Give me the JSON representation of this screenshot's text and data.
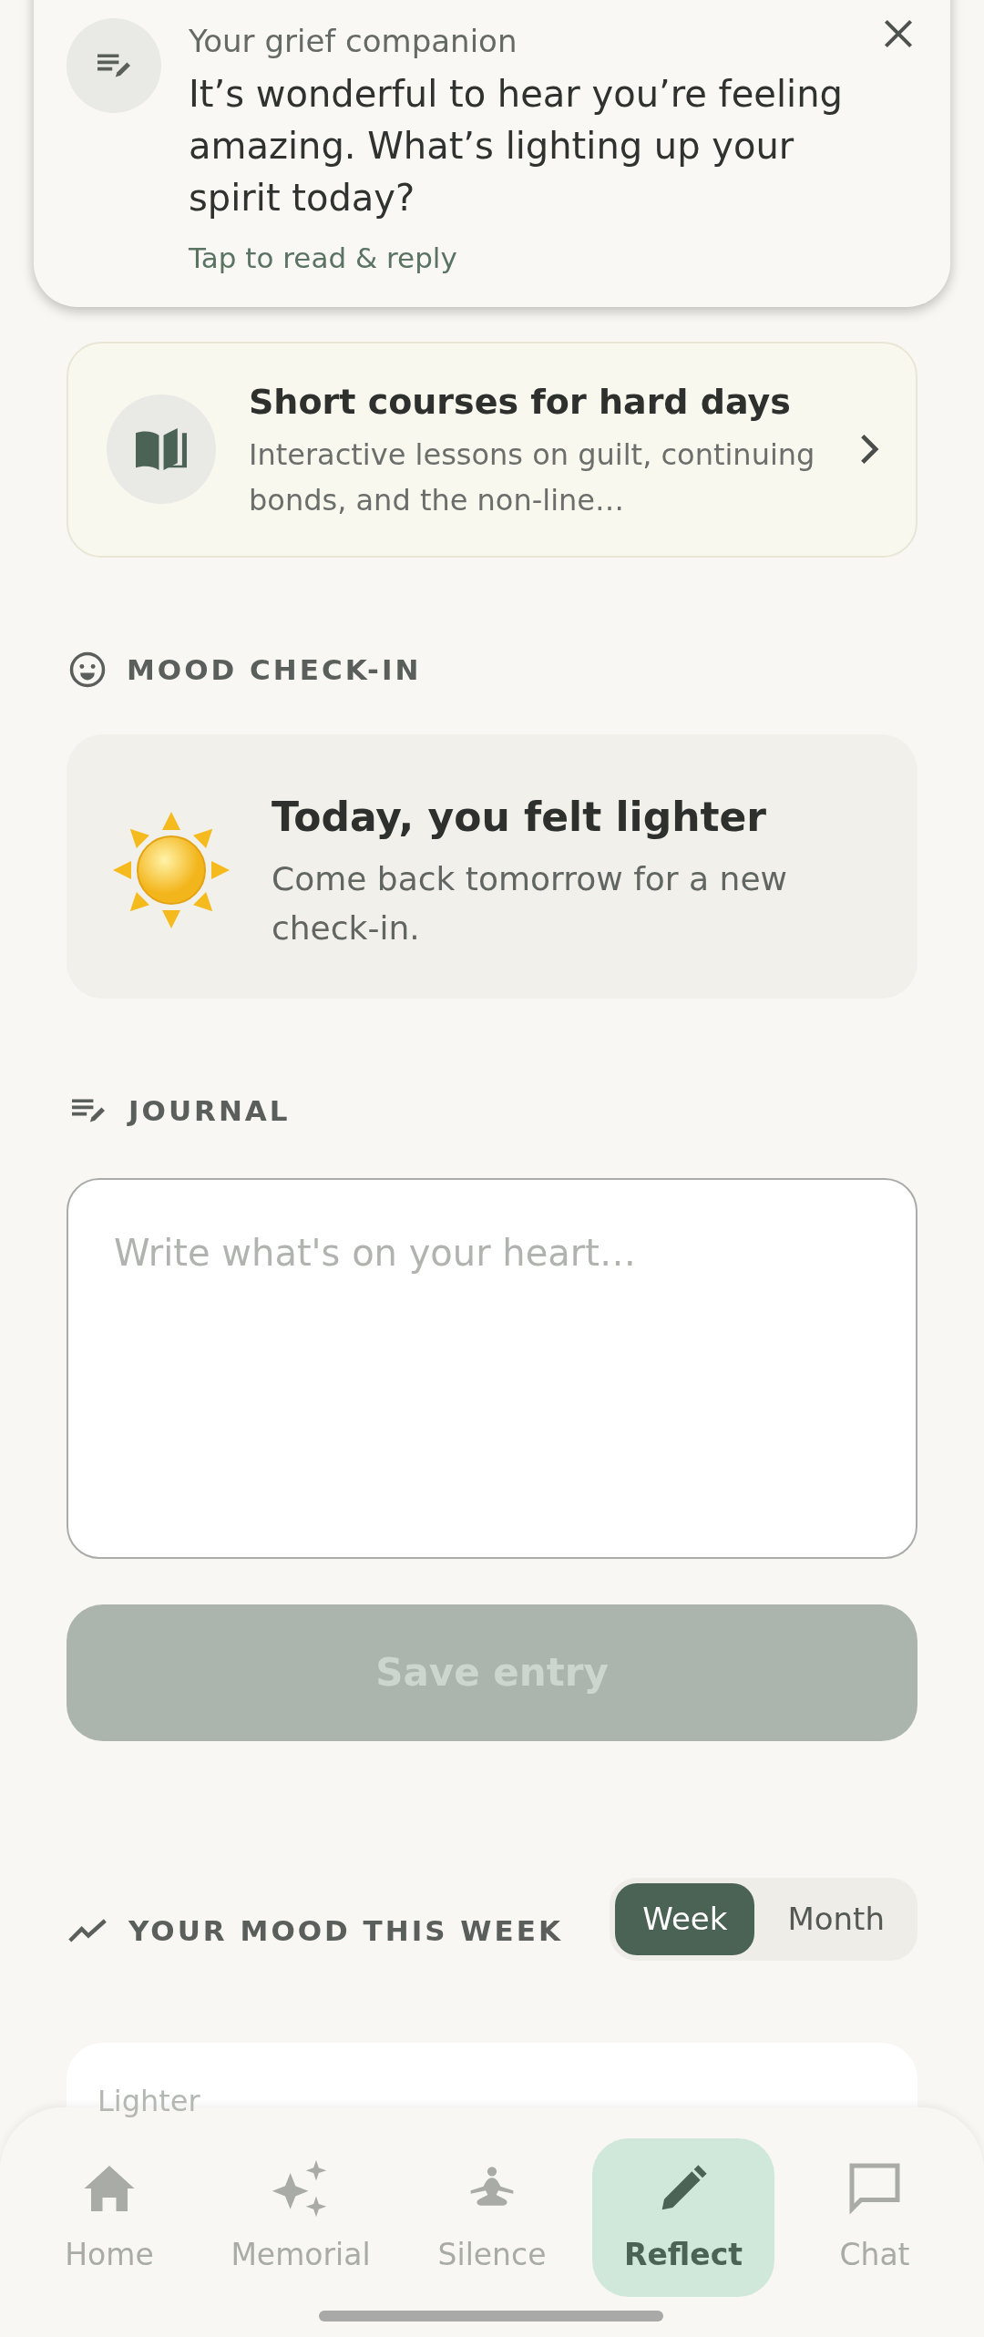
{
  "notification": {
    "title": "Your grief companion",
    "message": "It’s wonderful to hear you’re feeling amazing. What’s lighting up your spirit today?",
    "action": "Tap to read & reply"
  },
  "course_card": {
    "title": "Short courses for hard days",
    "subtitle": "Interactive lessons on guilt, continuing bonds, and the non-line…"
  },
  "mood_checkin": {
    "heading": "MOOD CHECK-IN",
    "title": "Today, you felt lighter",
    "subtitle": "Come back tomorrow for a new check-in."
  },
  "journal": {
    "heading": "JOURNAL",
    "placeholder": "Write what's on your heart…",
    "save_button": {
      "label": "Save entry",
      "disabled": true
    }
  },
  "mood_week": {
    "heading": "YOUR MOOD THIS WEEK",
    "ranges": [
      {
        "label": "Week",
        "selected": true
      },
      {
        "label": "Month",
        "selected": false
      }
    ],
    "chart_label": "Lighter"
  },
  "nav": [
    {
      "label": "Home",
      "kind": "home",
      "selected": false
    },
    {
      "label": "Memorial",
      "kind": "sparkle",
      "selected": false
    },
    {
      "label": "Silence",
      "kind": "meditate",
      "selected": false
    },
    {
      "label": "Reflect",
      "kind": "pencil",
      "selected": true
    },
    {
      "label": "Chat",
      "kind": "chat",
      "selected": false
    }
  ]
}
